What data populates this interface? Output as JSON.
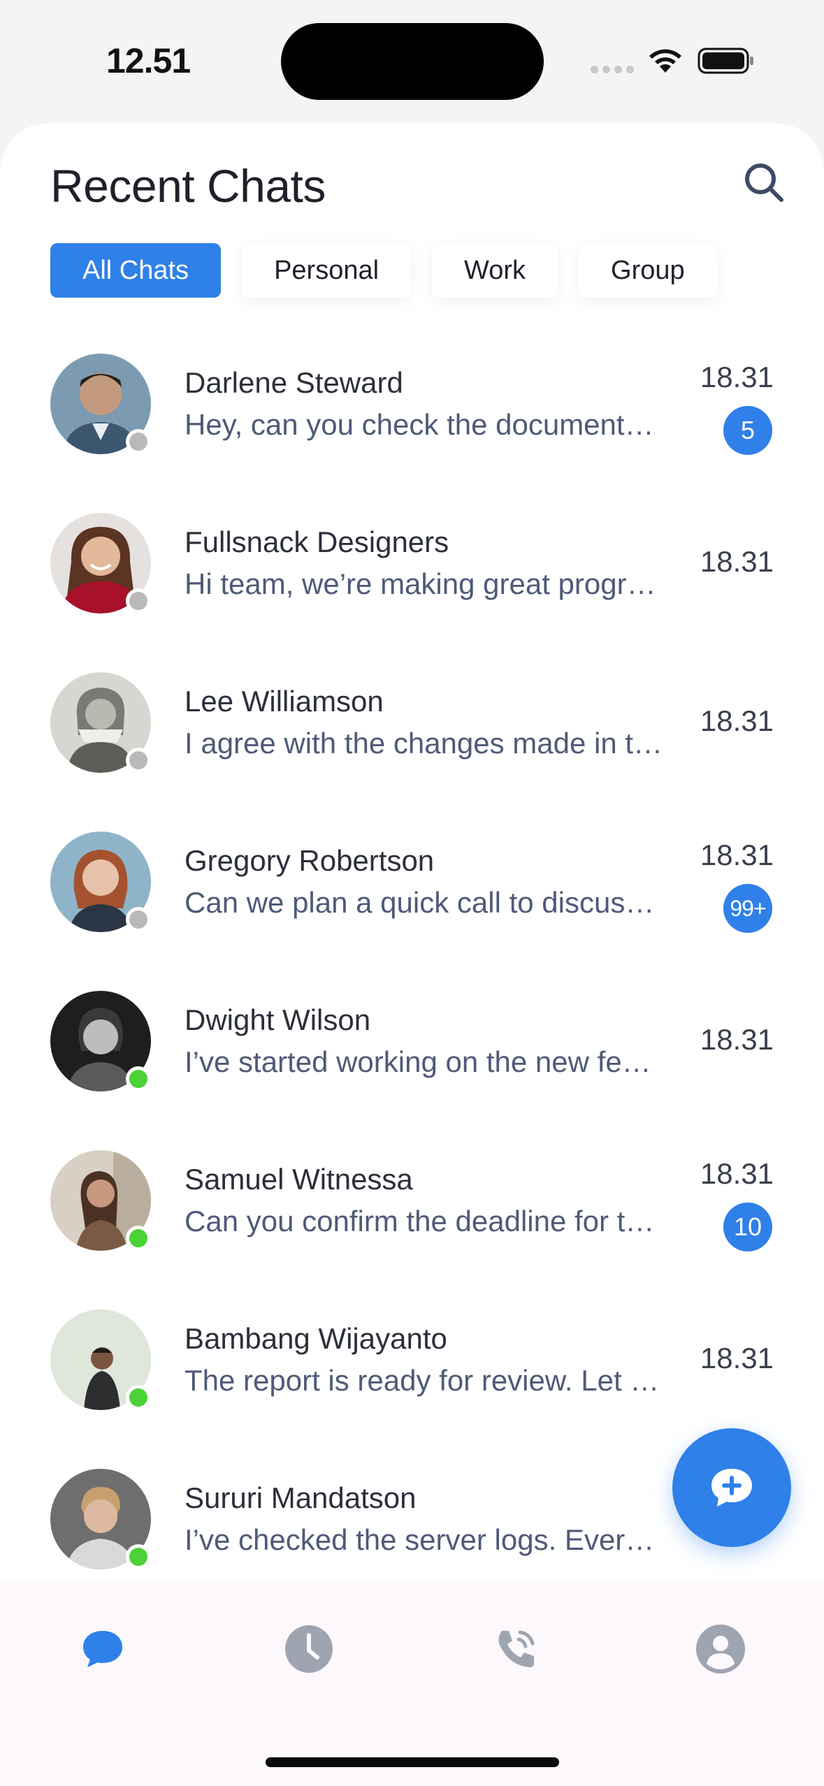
{
  "status_bar": {
    "time": "12.51"
  },
  "header": {
    "title": "Recent Chats"
  },
  "tabs": [
    {
      "label": "All Chats",
      "active": true
    },
    {
      "label": "Personal",
      "active": false
    },
    {
      "label": "Work",
      "active": false
    },
    {
      "label": "Group",
      "active": false
    }
  ],
  "chats": [
    {
      "name": "Darlene Steward",
      "preview": "Hey, can you check the document…",
      "time": "18.31",
      "unread": "5",
      "online": false
    },
    {
      "name": "Fullsnack Designers",
      "preview": "Hi team, we’re making great progr…",
      "time": "18.31",
      "unread": "",
      "online": false
    },
    {
      "name": "Lee Williamson",
      "preview": "I agree with the changes made in t…",
      "time": "18.31",
      "unread": "",
      "online": false
    },
    {
      "name": "Gregory Robertson",
      "preview": "Can we plan a quick call to discus…",
      "time": "18.31",
      "unread": "99+",
      "online": false
    },
    {
      "name": "Dwight Wilson",
      "preview": "I’ve started working on the new fe…",
      "time": "18.31",
      "unread": "",
      "online": true
    },
    {
      "name": "Samuel Witnessa",
      "preview": "Can you confirm the deadline for t…",
      "time": "18.31",
      "unread": "10",
      "online": true
    },
    {
      "name": "Bambang Wijayanto",
      "preview": "The report is ready for review. Let …",
      "time": "18.31",
      "unread": "",
      "online": true
    },
    {
      "name": "Sururi Mandatson",
      "preview": "I’ve checked the server logs. Ever…",
      "time": "",
      "unread": "",
      "online": true
    }
  ],
  "fab": {
    "icon": "new-chat-icon"
  },
  "bottom_nav": [
    {
      "icon": "chat-bubble-icon",
      "active": true
    },
    {
      "icon": "clock-icon",
      "active": false
    },
    {
      "icon": "phone-call-icon",
      "active": false
    },
    {
      "icon": "profile-icon",
      "active": false
    }
  ],
  "colors": {
    "accent": "#2f80e8",
    "online": "#4cd137",
    "offline": "#b9b9b9",
    "preview_text": "#4e5a78",
    "nav_inactive": "#9ea4b0"
  }
}
